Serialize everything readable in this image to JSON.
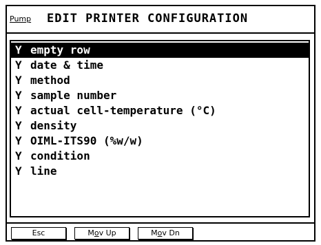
{
  "header": {
    "mode_label": "Pump",
    "title": "EDIT PRINTER CONFIGURATION"
  },
  "list": {
    "items": [
      {
        "flag": "Y",
        "label": "empty row",
        "selected": true
      },
      {
        "flag": "Y",
        "label": "date & time",
        "selected": false
      },
      {
        "flag": "Y",
        "label": "method",
        "selected": false
      },
      {
        "flag": "Y",
        "label": "sample number",
        "selected": false
      },
      {
        "flag": "Y",
        "label": "actual cell-temperature (°C)",
        "selected": false
      },
      {
        "flag": "Y",
        "label": "density",
        "selected": false
      },
      {
        "flag": "Y",
        "label": "OIML-ITS90 (%w/w)",
        "selected": false
      },
      {
        "flag": "Y",
        "label": "condition",
        "selected": false
      },
      {
        "flag": "Y",
        "label": "line",
        "selected": false
      }
    ]
  },
  "softkeys": {
    "esc": "Esc",
    "mov_up_prefix": "M",
    "mov_up_underlined": "o",
    "mov_up_suffix": "v Up",
    "mov_dn_prefix": "M",
    "mov_dn_underlined": "o",
    "mov_dn_suffix": "v Dn"
  }
}
